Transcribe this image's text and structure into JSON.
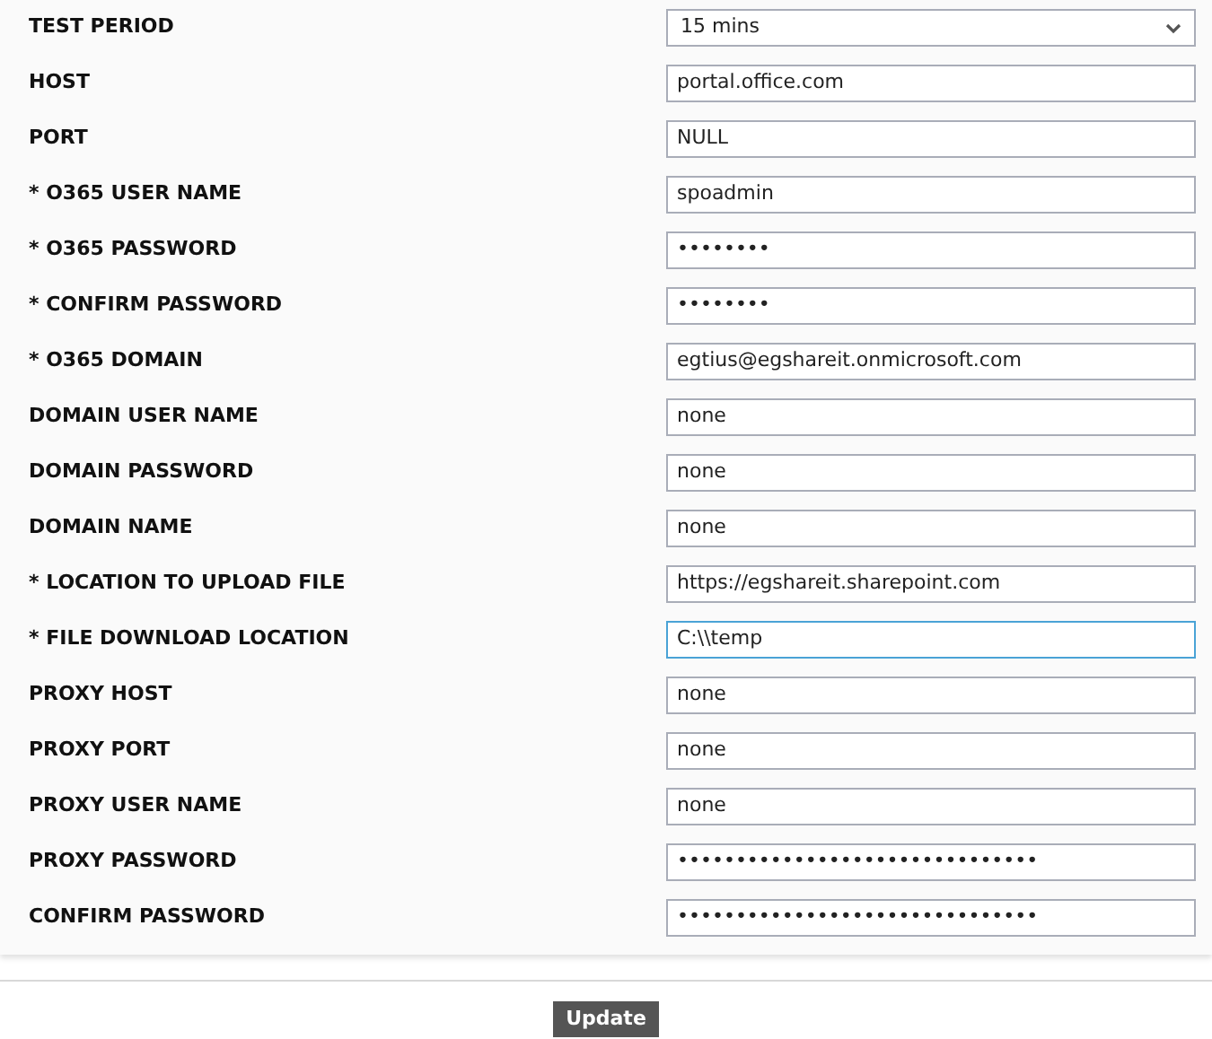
{
  "fields": [
    {
      "label": "TEST PERIOD",
      "kind": "select",
      "value": "15 mins",
      "focused": false
    },
    {
      "label": "HOST",
      "kind": "text",
      "value": "portal.office.com",
      "focused": false
    },
    {
      "label": "PORT",
      "kind": "text",
      "value": "NULL",
      "focused": false
    },
    {
      "label": "* O365 USER NAME",
      "kind": "text",
      "value": "spoadmin",
      "focused": false
    },
    {
      "label": "* O365 PASSWORD",
      "kind": "text",
      "value": "••••••••",
      "focused": false
    },
    {
      "label": "* CONFIRM PASSWORD",
      "kind": "text",
      "value": "••••••••",
      "focused": false
    },
    {
      "label": "* O365 DOMAIN",
      "kind": "text",
      "value": "egtius@egshareit.onmicrosoft.com",
      "focused": false
    },
    {
      "label": "DOMAIN USER NAME",
      "kind": "text",
      "value": "none",
      "focused": false
    },
    {
      "label": "DOMAIN PASSWORD",
      "kind": "text",
      "value": "none",
      "focused": false
    },
    {
      "label": "DOMAIN NAME",
      "kind": "text",
      "value": "none",
      "focused": false
    },
    {
      "label": "* LOCATION TO UPLOAD FILE",
      "kind": "text",
      "value": "https://egshareit.sharepoint.com",
      "focused": false
    },
    {
      "label": "* FILE DOWNLOAD LOCATION",
      "kind": "text",
      "value": "C:\\\\temp",
      "focused": true
    },
    {
      "label": "PROXY HOST",
      "kind": "text",
      "value": "none",
      "focused": false
    },
    {
      "label": "PROXY PORT",
      "kind": "text",
      "value": "none",
      "focused": false
    },
    {
      "label": "PROXY USER NAME",
      "kind": "text",
      "value": "none",
      "focused": false
    },
    {
      "label": "PROXY PASSWORD",
      "kind": "text",
      "value": "•••••••••••••••••••••••••••••••",
      "focused": false
    },
    {
      "label": "CONFIRM PASSWORD",
      "kind": "text",
      "value": "•••••••••••••••••••••••••••••••",
      "focused": false
    }
  ],
  "button": "Update"
}
